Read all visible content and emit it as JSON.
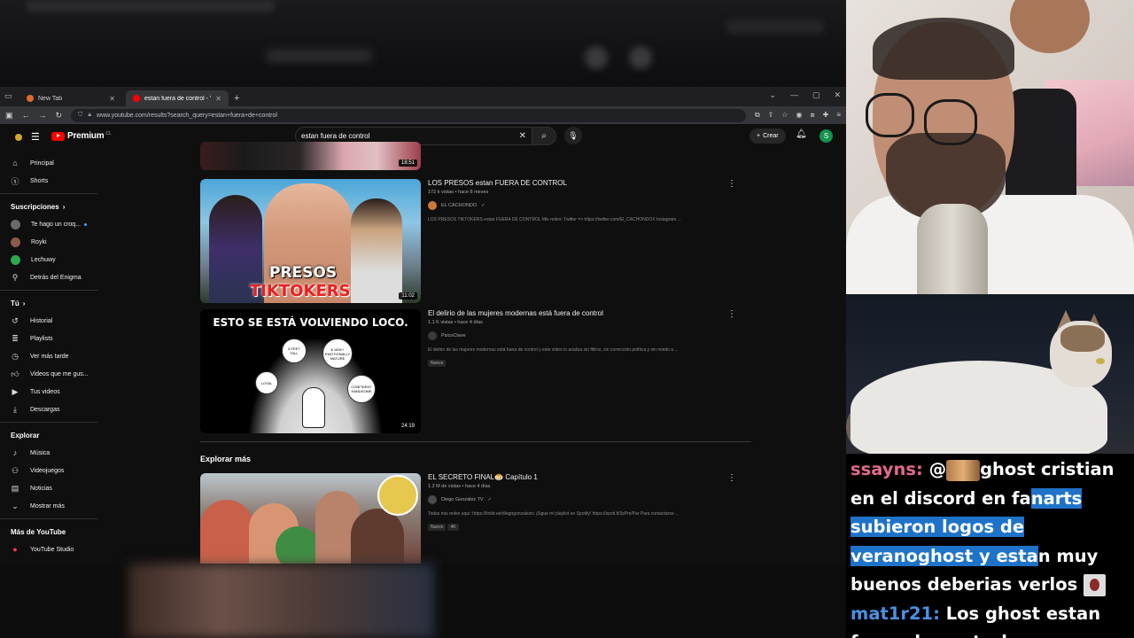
{
  "browser": {
    "tabs": [
      {
        "label": "New Tab",
        "favicon_color": "#e06a2b"
      },
      {
        "label": "estan fuera de control - YouTube",
        "favicon_color": "#ff0000"
      }
    ],
    "url": "www.youtube.com/results?search_query=estan+fuera+de+control"
  },
  "youtube": {
    "logo_text": "Premium",
    "country_code": "CL",
    "search_value": "estan fuera de control",
    "create_label": "Crear",
    "avatar_letter": "S",
    "sidebar": {
      "main": [
        {
          "label": "Principal",
          "icon": "home-icon"
        },
        {
          "label": "Shorts",
          "icon": "shorts-icon"
        }
      ],
      "subscriptions_title": "Suscripciones",
      "subscriptions": [
        {
          "label": "Te hago un croq...",
          "color": "#6b6b6b",
          "live": true
        },
        {
          "label": "Royki",
          "color": "#8a5a4a",
          "live": false
        },
        {
          "label": "Lechuwy",
          "color": "#2fa84f",
          "live": false
        },
        {
          "label": "Detrás del Enigma",
          "color": "#555555",
          "live": false
        }
      ],
      "you_title": "Tú",
      "you": [
        {
          "label": "Historial",
          "icon": "history-icon"
        },
        {
          "label": "Playlists",
          "icon": "playlists-icon"
        },
        {
          "label": "Ver más tarde",
          "icon": "watch-later-icon"
        },
        {
          "label": "Videos que me gus...",
          "icon": "like-icon"
        },
        {
          "label": "Tus videos",
          "icon": "your-videos-icon"
        },
        {
          "label": "Descargas",
          "icon": "downloads-icon"
        }
      ],
      "explore_title": "Explorar",
      "explore": [
        {
          "label": "Música",
          "icon": "music-icon"
        },
        {
          "label": "Videojuegos",
          "icon": "gaming-icon"
        },
        {
          "label": "Noticias",
          "icon": "news-icon"
        },
        {
          "label": "Mostrar más",
          "icon": "chevron-down-icon"
        }
      ],
      "more_title": "Más de YouTube",
      "more": [
        {
          "label": "YouTube Studio",
          "icon": "studio-icon"
        }
      ]
    },
    "results": {
      "partial_duration": "18:51",
      "videos": [
        {
          "title": "LOS PRESOS estan FUERA DE CONTROL",
          "meta": "172 k vistas • hace 8 meses",
          "channel": "EL CACHONDO",
          "description": "LOS PRESOS TIKTOKERS estan FUERA DE CONTROL Mis redes: Twitter => https://twitter.com/El_CACHONDOX Instagram ...",
          "duration": "11:02",
          "thumb_text_1": "PRESOS",
          "thumb_text_2": "TIKTOKERS",
          "badges": []
        },
        {
          "title": "El delirio de las mujeres modernas está fuera de control",
          "meta": "1.1 K vistas • hace 4 días",
          "channel": "PsicoClave",
          "description": "El delirio de las mujeres modernas está fuera de control y este video lo analiza sin filtros, sin corrección política y sin miedo a ...",
          "duration": "24:19",
          "thumb_heading": "ESTO SE ESTÁ VOLVIENDO LOCO.",
          "bubbles": [
            "6 FEET TALL",
            "$ 100K+ EMOTIONALLY MATURE",
            "LOYAL",
            "CONFIDENT HANDSOME"
          ],
          "badges": [
            "Nuevo"
          ]
        }
      ],
      "explore_title": "Explorar más",
      "explore_video": {
        "title": "EL SECRETO FINAL🍮 Capítulo 1",
        "meta": "1.2 M de vistas • hace 4 días",
        "channel": "Diego González TV",
        "description": "Todas mis redes aquí: https://linktr.ee/diegogonzaleztv ¡Sigue mi playlist en Spotify! https://spoti.fi/3zPm/Par Para contactarse ...",
        "badges": [
          "Nuevo",
          "4K"
        ]
      }
    }
  },
  "chat": {
    "messages": [
      {
        "user": "ssayns",
        "parts": [
          {
            "text": "@",
            "hl": false
          },
          {
            "emote": true
          },
          {
            "text": "ghost cristian en el discord en fa",
            "hl": false
          },
          {
            "text": "narts subieron logos de veranoghost y esta",
            "hl": true
          },
          {
            "text": "n muy buenos deberias verlos ",
            "hl": false
          },
          {
            "emote2": true
          }
        ]
      },
      {
        "user": "mat1r21",
        "parts": [
          {
            "text": "Los ghost estan fuera de control",
            "hl": false
          }
        ]
      }
    ]
  }
}
